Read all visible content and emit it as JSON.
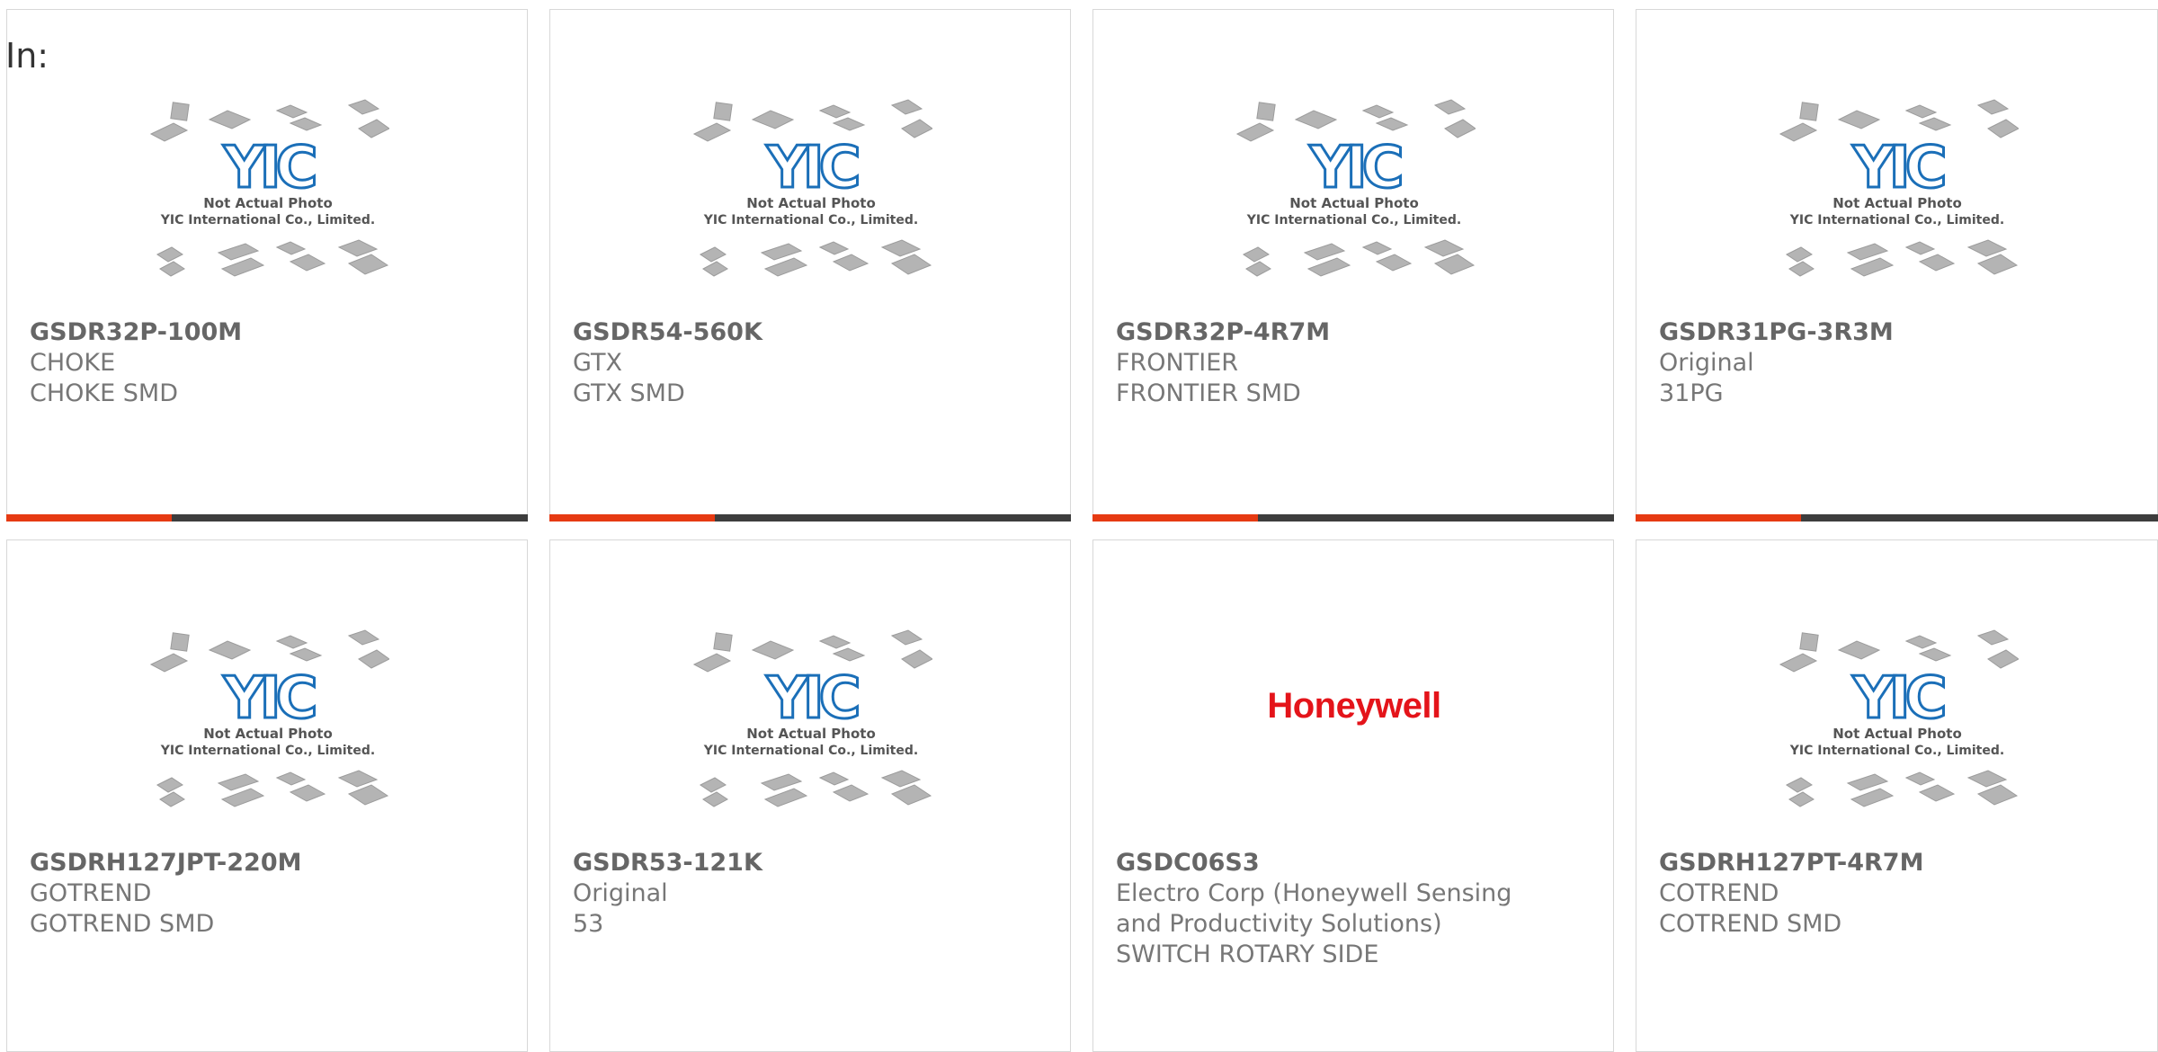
{
  "filter_label": "In:",
  "placeholder_image": {
    "logo_text": "YIC",
    "caption_line1": "Not Actual Photo",
    "caption_line2": "YIC International Co., Limited."
  },
  "products": [
    {
      "part_number": "GSDR32P-100M",
      "manufacturer": "CHOKE",
      "description": "CHOKE SMD",
      "image": "yic-placeholder"
    },
    {
      "part_number": "GSDR54-560K",
      "manufacturer": "GTX",
      "description": "GTX SMD",
      "image": "yic-placeholder"
    },
    {
      "part_number": "GSDR32P-4R7M",
      "manufacturer": "FRONTIER",
      "description": "FRONTIER SMD",
      "image": "yic-placeholder"
    },
    {
      "part_number": "GSDR31PG-3R3M",
      "manufacturer": "Original",
      "description": "31PG",
      "image": "yic-placeholder"
    },
    {
      "part_number": "GSDRH127JPT-220M",
      "manufacturer": "GOTREND",
      "description": "GOTREND SMD",
      "image": "yic-placeholder"
    },
    {
      "part_number": "GSDR53-121K",
      "manufacturer": "Original",
      "description": "53",
      "image": "yic-placeholder"
    },
    {
      "part_number": "GSDC06S3",
      "manufacturer_line1": "Electro Corp (Honeywell Sensing",
      "manufacturer_line2": "and Productivity Solutions)",
      "description": "SWITCH ROTARY SIDE",
      "image": "honeywell-logo",
      "logo_text": "Honeywell"
    },
    {
      "part_number": "GSDRH127PT-4R7M",
      "manufacturer": "COTREND",
      "description": "COTREND SMD",
      "image": "yic-placeholder"
    }
  ],
  "colors": {
    "accent_bar": "#e63a12",
    "bar_dark": "#3d3d3d",
    "yic_blue": "#1b6fb8",
    "honeywell_red": "#e4141a"
  }
}
